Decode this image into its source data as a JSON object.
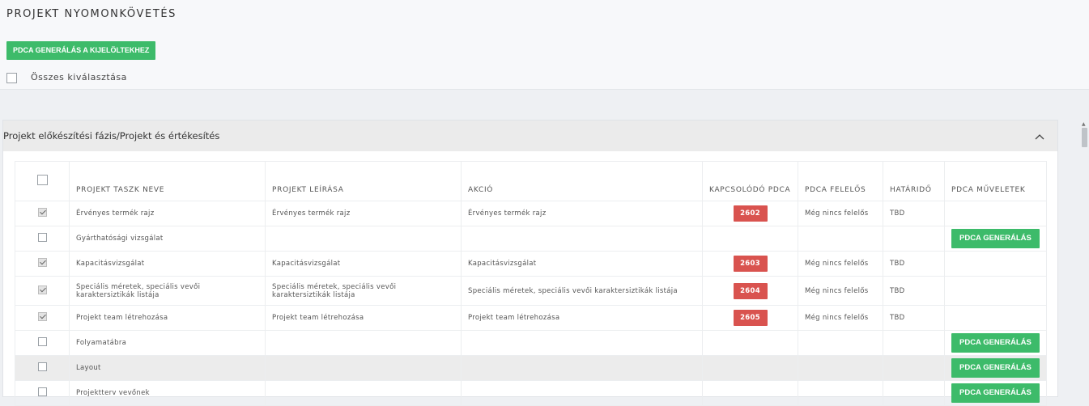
{
  "page": {
    "title": "PROJEKT NYOMONKÖVETÉS",
    "generate_selected_label": "PDCA GENERÁLÁS A KIJELÖLTEKHEZ",
    "select_all_label": "Összes kiválasztása"
  },
  "panel": {
    "title": "Projekt előkészítési fázis/Projekt és értékesítés",
    "collapse_icon": "chevron-up-icon"
  },
  "table": {
    "headers": {
      "task": "PROJEKT TASZK NEVE",
      "description": "PROJEKT LEÍRÁSA",
      "action": "AKCIÓ",
      "pdca": "KAPCSOLÓDÓ PDCA",
      "owner": "PDCA FELELŐS",
      "deadline": "HATÁRIDŐ",
      "ops": "PDCA MŰVELETEK"
    },
    "generate_label": "PDCA GENERÁLÁS",
    "rows": [
      {
        "checked": true,
        "task": "Érvényes termék rajz",
        "description": "Érvényes termék rajz",
        "action": "Érvényes termék rajz",
        "pdca": "2602",
        "owner": "Még nincs felelős",
        "deadline": "TBD"
      },
      {
        "checked": false,
        "task": "Gyárthatósági vizsgálat",
        "description": "",
        "action": "",
        "pdca": "",
        "owner": "",
        "deadline": ""
      },
      {
        "checked": true,
        "task": "Kapacitásvizsgálat",
        "description": "Kapacitásvizsgálat",
        "action": "Kapacitásvizsgálat",
        "pdca": "2603",
        "owner": "Még nincs felelős",
        "deadline": "TBD"
      },
      {
        "checked": true,
        "task": "Speciális méretek, speciális vevői karaktersiztikák listája",
        "description": "Speciális méretek, speciális vevői karaktersiztikák listája",
        "action": "Speciális méretek, speciális vevői karaktersiztikák listája",
        "pdca": "2604",
        "owner": "Még nincs felelős",
        "deadline": "TBD"
      },
      {
        "checked": true,
        "task": "Projekt team létrehozása",
        "description": "Projekt team létrehozása",
        "action": "Projekt team létrehozása",
        "pdca": "2605",
        "owner": "Még nincs felelős",
        "deadline": "TBD"
      },
      {
        "checked": false,
        "task": "Folyamatábra",
        "description": "",
        "action": "",
        "pdca": "",
        "owner": "",
        "deadline": ""
      },
      {
        "checked": false,
        "task": "Layout",
        "description": "",
        "action": "",
        "pdca": "",
        "owner": "",
        "deadline": ""
      },
      {
        "checked": false,
        "task": "Projektterv vevőnek",
        "description": "",
        "action": "",
        "pdca": "",
        "owner": "",
        "deadline": ""
      }
    ]
  },
  "colors": {
    "accent_green": "#3dbb6a",
    "pdca_red": "#d9534f",
    "row_highlight": "#ececec"
  }
}
